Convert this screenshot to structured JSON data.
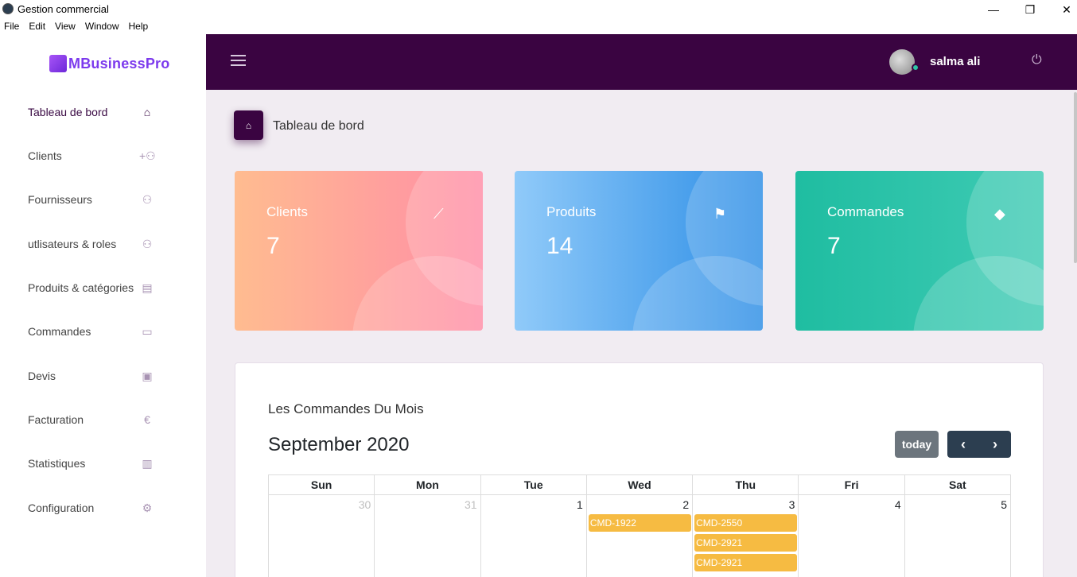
{
  "window": {
    "title": "Gestion commercial",
    "minimize": "—",
    "restore": "❐",
    "close": "✕"
  },
  "menu": [
    "File",
    "Edit",
    "View",
    "Window",
    "Help"
  ],
  "brand": {
    "logo_text": "MBusinessPro"
  },
  "sidebar": {
    "items": [
      {
        "label": "Tableau de bord",
        "icon": "home-icon",
        "glyph": "⌂"
      },
      {
        "label": "Clients",
        "icon": "add-user-icon",
        "glyph": "+⚇"
      },
      {
        "label": "Fournisseurs",
        "icon": "users-icon",
        "glyph": "⚇"
      },
      {
        "label": "utlisateurs & roles",
        "icon": "user-roles-icon",
        "glyph": "⚇"
      },
      {
        "label": "Produits & catégories",
        "icon": "list-icon",
        "glyph": "▤"
      },
      {
        "label": "Commandes",
        "icon": "monitor-icon",
        "glyph": "▭"
      },
      {
        "label": "Devis",
        "icon": "document-icon",
        "glyph": "▣"
      },
      {
        "label": "Facturation",
        "icon": "euro-icon",
        "glyph": "€"
      },
      {
        "label": "Statistiques",
        "icon": "bar-chart-icon",
        "glyph": "▥"
      },
      {
        "label": "Configuration",
        "icon": "gear-icon",
        "glyph": "⚙"
      }
    ]
  },
  "topbar": {
    "username": "salma ali",
    "power_glyph": "⏻"
  },
  "breadcrumb": {
    "title": "Tableau de bord",
    "home_glyph": "⌂"
  },
  "cards": [
    {
      "title": "Clients",
      "value": "7",
      "icon": "line-chart-icon",
      "glyph": "⟋"
    },
    {
      "title": "Produits",
      "value": "14",
      "icon": "bookmark-icon",
      "glyph": "⚑"
    },
    {
      "title": "Commandes",
      "value": "7",
      "icon": "diamond-icon",
      "glyph": "◆"
    }
  ],
  "calendar": {
    "heading": "Les Commandes Du Mois",
    "month": "September 2020",
    "today_label": "today",
    "prev_glyph": "‹",
    "next_glyph": "›",
    "weekdays": [
      "Sun",
      "Mon",
      "Tue",
      "Wed",
      "Thu",
      "Fri",
      "Sat"
    ],
    "days": [
      "30",
      "31",
      "1",
      "2",
      "3",
      "4",
      "5"
    ],
    "events": {
      "wed": [
        "CMD-1922"
      ],
      "thu": [
        "CMD-2550",
        "CMD-2921",
        "CMD-2921"
      ]
    }
  },
  "colors": {
    "primary": "#3a0441",
    "card_clients": "#fea3a3",
    "card_produits": "#3f9ae8",
    "card_commandes": "#25c1a6",
    "event": "#f6bb42"
  }
}
